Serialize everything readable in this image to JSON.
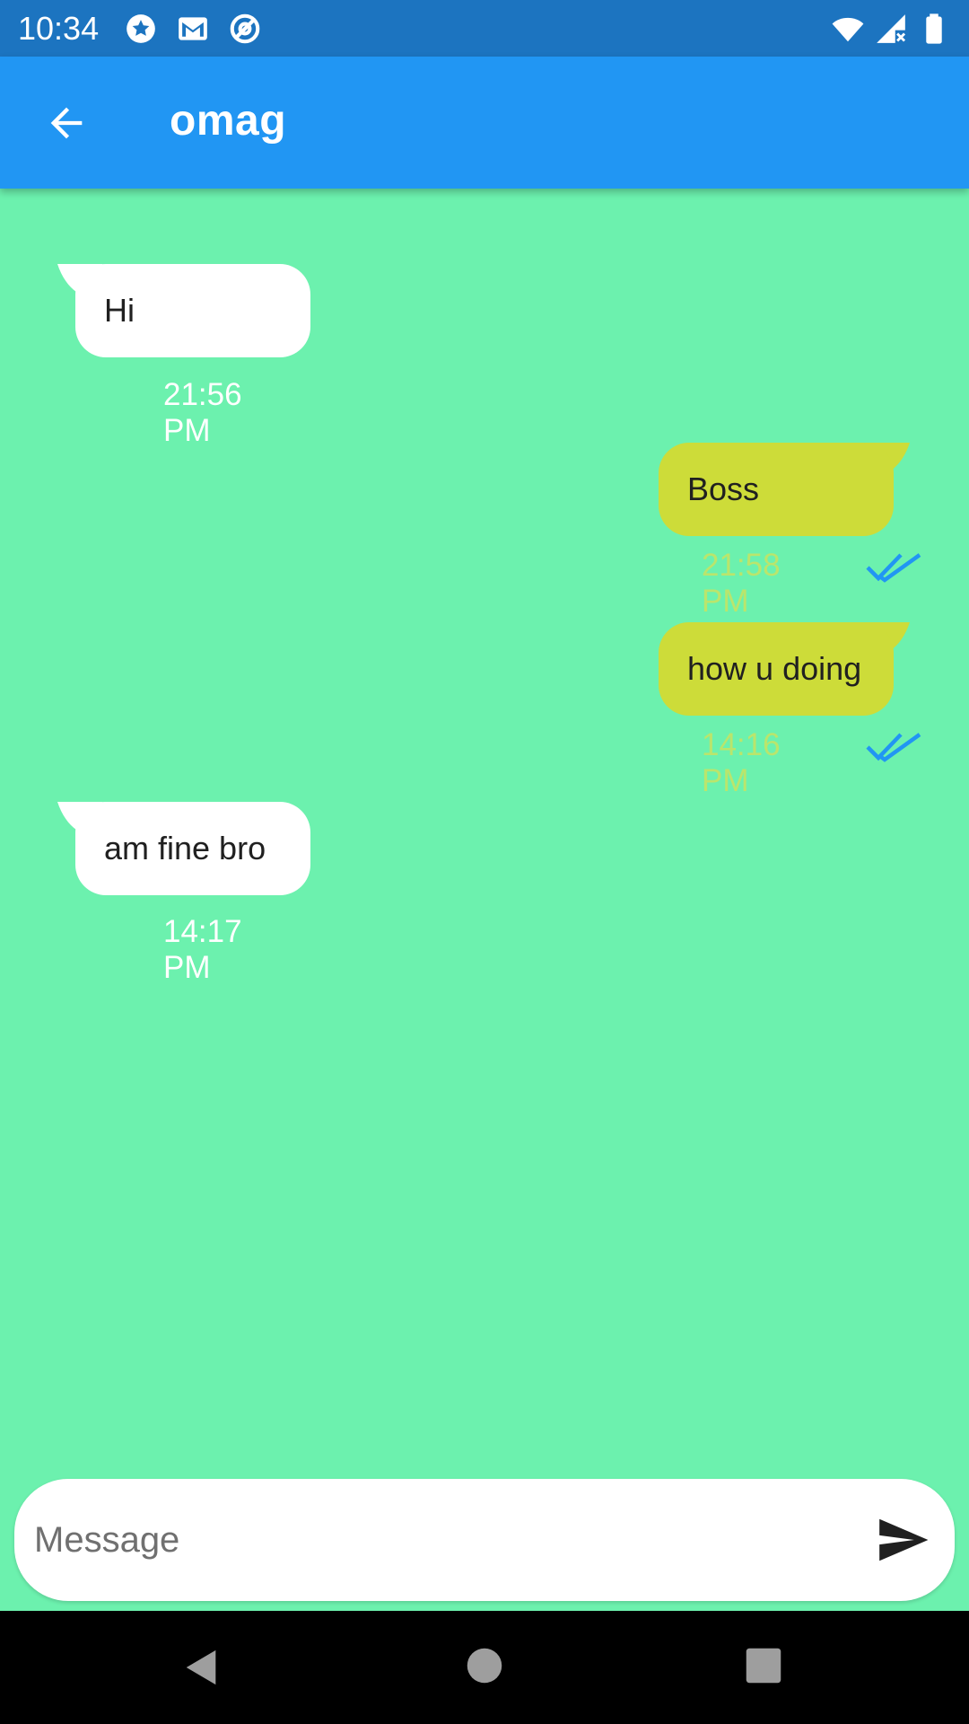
{
  "status_bar": {
    "time": "10:34",
    "icons_left": [
      "star-badge-icon",
      "gmail-icon",
      "at-sign-icon"
    ],
    "icons_right": [
      "wifi-icon",
      "signal-icon",
      "battery-icon"
    ]
  },
  "app_bar": {
    "back_icon": "arrow-back-icon",
    "title": "omag",
    "color": "#2196f3"
  },
  "chat": {
    "background": "#6cf1ae",
    "messages": [
      {
        "direction": "incoming",
        "text": "Hi",
        "time": "21:56 PM"
      },
      {
        "direction": "outgoing",
        "text": "Boss",
        "time": "21:58 PM",
        "status": "read"
      },
      {
        "direction": "outgoing",
        "text": "how u doing",
        "time": "14:16 PM",
        "status": "read"
      },
      {
        "direction": "incoming",
        "text": "am fine bro",
        "time": "14:17 PM"
      }
    ],
    "incoming_bubble_color": "#ffffff",
    "outgoing_bubble_color": "#cddc39",
    "read_tick_color": "#2196f3"
  },
  "composer": {
    "placeholder": "Message",
    "value": "",
    "send_icon": "send-icon"
  },
  "nav_bar": {
    "buttons": [
      "back-triangle-icon",
      "home-circle-icon",
      "recents-square-icon"
    ]
  }
}
